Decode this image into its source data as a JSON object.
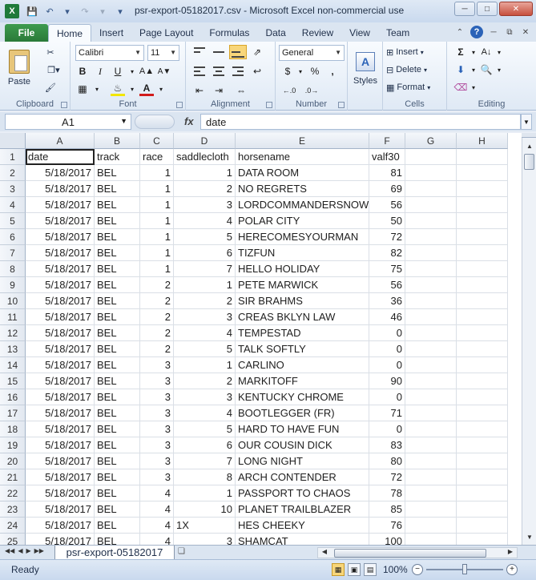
{
  "window": {
    "title": "psr-export-05182017.csv  -  Microsoft Excel non-commercial use",
    "app_icon_label": "X"
  },
  "ribbon": {
    "tabs": [
      "Home",
      "Insert",
      "Page Layout",
      "Formulas",
      "Data",
      "Review",
      "View",
      "Team"
    ],
    "file_tab": "File",
    "active_tab": "Home",
    "groups": {
      "clipboard": {
        "label": "Clipboard",
        "paste": "Paste"
      },
      "font": {
        "label": "Font",
        "name": "Calibri",
        "size": "11"
      },
      "alignment": {
        "label": "Alignment"
      },
      "number": {
        "label": "Number",
        "format": "General",
        "percent": "%",
        "comma": ",",
        "currency": "$"
      },
      "styles": {
        "label": "Styles"
      },
      "cells": {
        "label": "Cells",
        "insert": "Insert",
        "delete": "Delete",
        "format": "Format"
      },
      "editing": {
        "label": "Editing"
      }
    }
  },
  "formula_bar": {
    "name_box": "A1",
    "fx": "fx",
    "value": "date"
  },
  "sheet": {
    "columns": [
      "A",
      "B",
      "C",
      "D",
      "E",
      "F",
      "G",
      "H"
    ],
    "row_numbers": [
      "1",
      "2",
      "3",
      "4",
      "5",
      "6",
      "7",
      "8",
      "9",
      "10",
      "11",
      "12",
      "13",
      "14",
      "15",
      "16",
      "17",
      "18",
      "19",
      "20",
      "21",
      "22",
      "23",
      "24",
      "25"
    ],
    "rows": [
      [
        "date",
        "track",
        "race",
        "saddlecloth",
        "horsename",
        "valf30",
        "",
        ""
      ],
      [
        "5/18/2017",
        "BEL",
        "1",
        "1",
        "DATA ROOM",
        "81",
        "",
        ""
      ],
      [
        "5/18/2017",
        "BEL",
        "1",
        "2",
        "NO REGRETS",
        "69",
        "",
        ""
      ],
      [
        "5/18/2017",
        "BEL",
        "1",
        "3",
        "LORDCOMMANDERSNOW",
        "56",
        "",
        ""
      ],
      [
        "5/18/2017",
        "BEL",
        "1",
        "4",
        "POLAR CITY",
        "50",
        "",
        ""
      ],
      [
        "5/18/2017",
        "BEL",
        "1",
        "5",
        "HERECOMESYOURMAN",
        "72",
        "",
        ""
      ],
      [
        "5/18/2017",
        "BEL",
        "1",
        "6",
        "TIZFUN",
        "82",
        "",
        ""
      ],
      [
        "5/18/2017",
        "BEL",
        "1",
        "7",
        "HELLO HOLIDAY",
        "75",
        "",
        ""
      ],
      [
        "5/18/2017",
        "BEL",
        "2",
        "1",
        "PETE MARWICK",
        "56",
        "",
        ""
      ],
      [
        "5/18/2017",
        "BEL",
        "2",
        "2",
        "SIR BRAHMS",
        "36",
        "",
        ""
      ],
      [
        "5/18/2017",
        "BEL",
        "2",
        "3",
        "CREAS BKLYN LAW",
        "46",
        "",
        ""
      ],
      [
        "5/18/2017",
        "BEL",
        "2",
        "4",
        "TEMPESTAD",
        "0",
        "",
        ""
      ],
      [
        "5/18/2017",
        "BEL",
        "2",
        "5",
        "TALK SOFTLY",
        "0",
        "",
        ""
      ],
      [
        "5/18/2017",
        "BEL",
        "3",
        "1",
        "CARLINO",
        "0",
        "",
        ""
      ],
      [
        "5/18/2017",
        "BEL",
        "3",
        "2",
        "MARKITOFF",
        "90",
        "",
        ""
      ],
      [
        "5/18/2017",
        "BEL",
        "3",
        "3",
        "KENTUCKY CHROME",
        "0",
        "",
        ""
      ],
      [
        "5/18/2017",
        "BEL",
        "3",
        "4",
        "BOOTLEGGER (FR)",
        "71",
        "",
        ""
      ],
      [
        "5/18/2017",
        "BEL",
        "3",
        "5",
        "HARD TO HAVE FUN",
        "0",
        "",
        ""
      ],
      [
        "5/18/2017",
        "BEL",
        "3",
        "6",
        "OUR COUSIN DICK",
        "83",
        "",
        ""
      ],
      [
        "5/18/2017",
        "BEL",
        "3",
        "7",
        "LONG NIGHT",
        "80",
        "",
        ""
      ],
      [
        "5/18/2017",
        "BEL",
        "3",
        "8",
        "ARCH CONTENDER",
        "72",
        "",
        ""
      ],
      [
        "5/18/2017",
        "BEL",
        "4",
        "1",
        "PASSPORT TO CHAOS",
        "78",
        "",
        ""
      ],
      [
        "5/18/2017",
        "BEL",
        "4",
        "10",
        "PLANET TRAILBLAZER",
        "85",
        "",
        ""
      ],
      [
        "5/18/2017",
        "BEL",
        "4",
        "1X",
        "HES CHEEKY",
        "76",
        "",
        ""
      ],
      [
        "5/18/2017",
        "BEL",
        "4",
        "3",
        "SHAMCAT",
        "100",
        "",
        ""
      ]
    ],
    "tab_name": "psr-export-05182017"
  },
  "status": {
    "text": "Ready",
    "zoom": "100%"
  }
}
